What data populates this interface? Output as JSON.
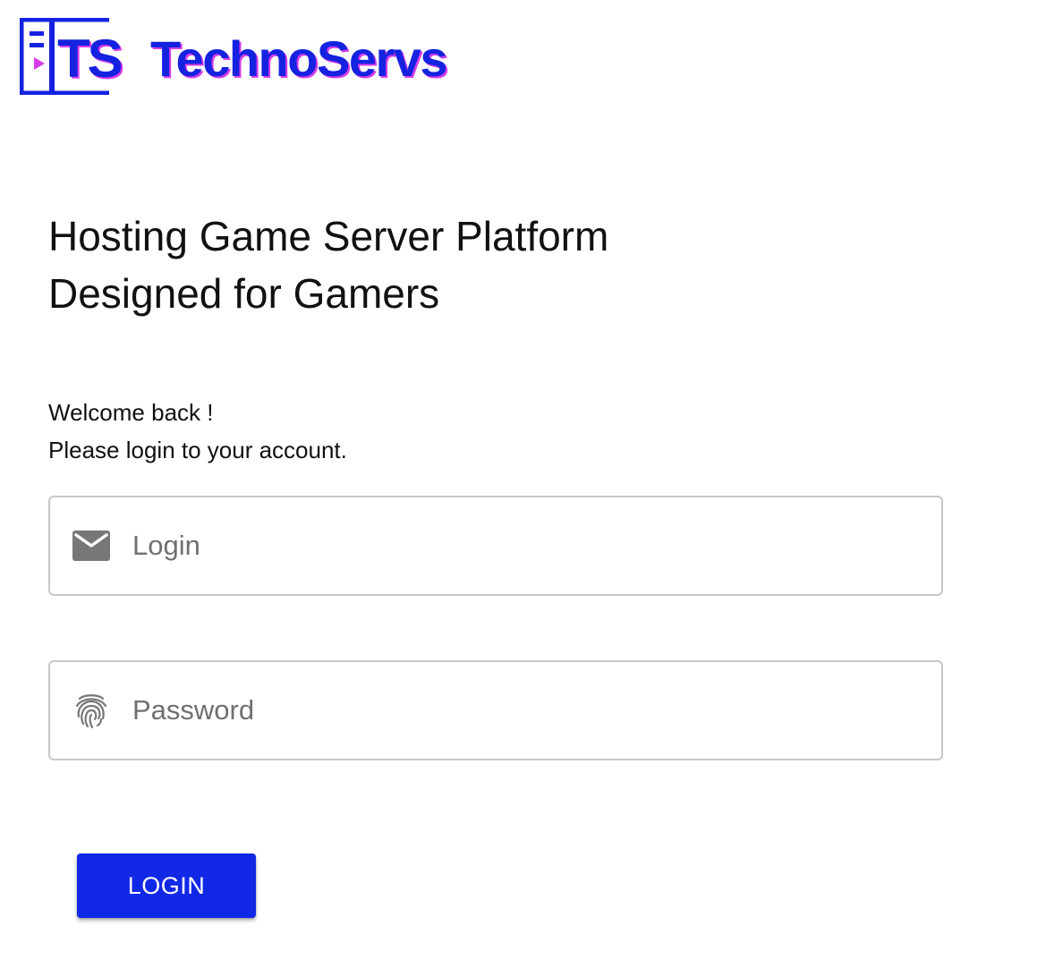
{
  "brand": {
    "mark_text": "TS",
    "name": "TechnoServs",
    "primary_color": "#1522e0",
    "accent_color": "#d63ce8"
  },
  "hero": {
    "line1": "Hosting Game Server Platform",
    "line2": "Designed for Gamers"
  },
  "welcome": {
    "line1": "Welcome back !",
    "line2": "Please login to your account."
  },
  "form": {
    "login": {
      "icon": "mail-icon",
      "placeholder": "Login",
      "value": ""
    },
    "password": {
      "icon": "fingerprint-icon",
      "placeholder": "Password",
      "value": ""
    },
    "submit_label": "LOGIN",
    "button_color": "#1128e6"
  }
}
